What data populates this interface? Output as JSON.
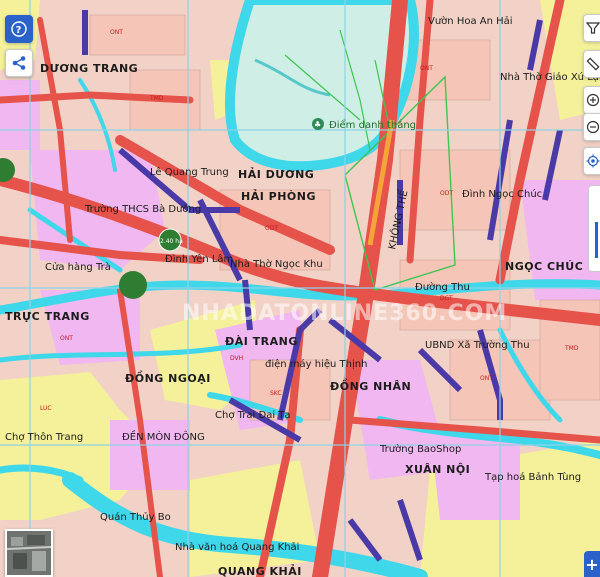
{
  "map": {
    "place_labels": [
      {
        "text": "HẢI DƯƠNG",
        "style": "lg"
      },
      {
        "text": "HẢI PHÒNG",
        "style": "lg"
      },
      {
        "text": "NGỌC CHÚC",
        "style": "lg"
      },
      {
        "text": "ĐÀI TRANG",
        "style": "lg"
      },
      {
        "text": "ĐỒNG NGOẠI",
        "style": "lg"
      },
      {
        "text": "ĐỒNG NHÂN",
        "style": "lg"
      },
      {
        "text": "XUÂN NỘI",
        "style": "lg"
      },
      {
        "text": "QUANG KHẢI",
        "style": "lg"
      },
      {
        "text": "TRỰC TRANG",
        "style": "lg"
      },
      {
        "text": "DƯƠNG TRANG",
        "style": "lg"
      }
    ],
    "poi_labels": [
      {
        "text": "Điểm danh thắng"
      },
      {
        "text": "Vườn Hoa An Hải"
      },
      {
        "text": "Nhà Thờ Giáo Xứ Lạc"
      },
      {
        "text": "Đình Ngọc Chúc"
      },
      {
        "text": "Trường THCS Bà Dưỡng"
      },
      {
        "text": "Đình Yên Lâm"
      },
      {
        "text": "UBND Xã Trường Thu"
      },
      {
        "text": "Lê Quang Trung"
      },
      {
        "text": "Chợ Trai Đại Tạ"
      },
      {
        "text": "ĐỀN MÒN ĐÔNG"
      },
      {
        "text": "Trường BaoShop"
      },
      {
        "text": "Tạp hoá Bảnh Tùng"
      },
      {
        "text": "Quán Thủy Bo"
      },
      {
        "text": "Nhà văn hoá Quang Khải"
      },
      {
        "text": "Chợ Thôn Trang"
      },
      {
        "text": "Cửa hàng Trà"
      },
      {
        "text": "Đường Thu"
      },
      {
        "text": "điện máy hiệu Thịnh"
      },
      {
        "text": "Nhà Thờ Ngọc Khu"
      }
    ],
    "road_labels": [
      {
        "text": "KHÔNG THỂ"
      }
    ],
    "markers": [
      {
        "label": "2.40 ha",
        "color": "#2f7d32"
      },
      {
        "label": "",
        "color": "#2f7d32"
      },
      {
        "label": "",
        "color": "#2f7d32"
      }
    ],
    "watermark": "NHADATONLINE360.COM",
    "colors": {
      "residential": "#f2d2c6",
      "residential_alt": "#f5c6b8",
      "mixed": "#f0b7f0",
      "agricultural": "#f4f19a",
      "water": "#3fd7ea",
      "lake": "#cfefe6",
      "main_road": "#e5534b",
      "boundary": "#4a3aa8",
      "grid": "#8fd2e6",
      "controls_accent": "#2a62c9"
    }
  },
  "controls": {
    "help": {
      "icon": "help-icon"
    },
    "share": {
      "icon": "share-icon"
    },
    "filter": {
      "icon": "filter-icon"
    },
    "measure": {
      "icon": "ruler-icon"
    },
    "zoom_in": {
      "icon": "zoom-in-icon"
    },
    "zoom_out": {
      "icon": "zoom-out-icon"
    },
    "locate": {
      "icon": "locate-icon"
    },
    "layer_panel": {
      "icon": "plus-icon",
      "label": "+"
    }
  }
}
